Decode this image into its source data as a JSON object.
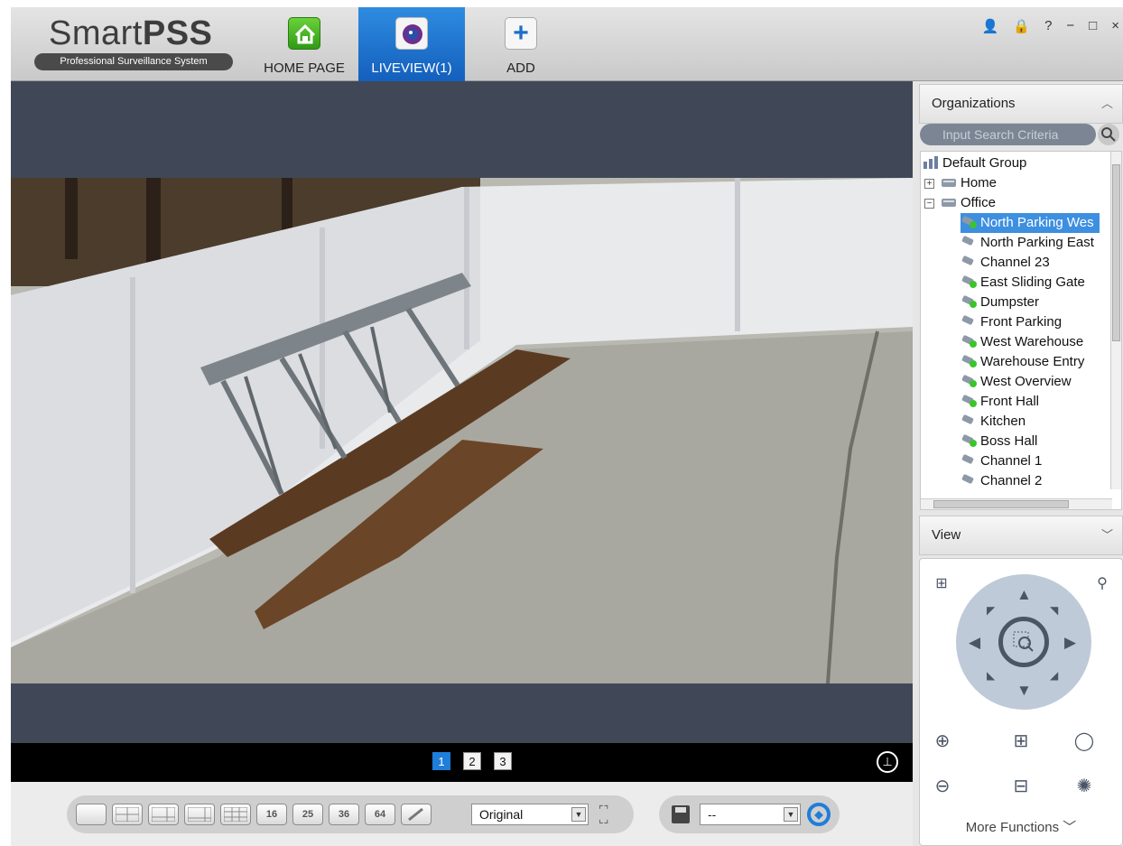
{
  "app": {
    "logo_main": "Smart",
    "logo_bold": "PSS",
    "logo_sub": "Professional Surveillance System"
  },
  "tabs": [
    {
      "label": "HOME PAGE",
      "icon": "home-icon"
    },
    {
      "label": "LIVEVIEW(1)",
      "icon": "camera-lens-icon"
    },
    {
      "label": "ADD",
      "icon": "plus-icon"
    }
  ],
  "window_controls": [
    "👤",
    "🔒",
    "?",
    "−",
    "□",
    "×"
  ],
  "pages": [
    "1",
    "2",
    "3"
  ],
  "active_page": "1",
  "toolbar": {
    "layouts": [
      "",
      "",
      "",
      "",
      "",
      "16",
      "25",
      "36",
      "64"
    ],
    "scale_value": "Original",
    "preset_value": "--"
  },
  "panel": {
    "organizations_title": "Organizations",
    "search_placeholder": "Input Search Criteria",
    "view_title": "View",
    "more_functions": "More Functions"
  },
  "tree": [
    {
      "label": "Default Group",
      "level": 0,
      "type": "group",
      "expander": ""
    },
    {
      "label": "Home",
      "level": 1,
      "type": "device",
      "expander": "+"
    },
    {
      "label": "Office",
      "level": 1,
      "type": "device",
      "expander": "−"
    },
    {
      "label": "North Parking Wes",
      "level": 2,
      "type": "camera-online",
      "selected": true
    },
    {
      "label": "North Parking East",
      "level": 2,
      "type": "camera-offline"
    },
    {
      "label": "Channel 23",
      "level": 2,
      "type": "camera-offline"
    },
    {
      "label": "East Sliding Gate",
      "level": 2,
      "type": "camera-online"
    },
    {
      "label": "Dumpster",
      "level": 2,
      "type": "camera-online"
    },
    {
      "label": "Front Parking",
      "level": 2,
      "type": "camera-offline"
    },
    {
      "label": "West Warehouse",
      "level": 2,
      "type": "camera-online"
    },
    {
      "label": "Warehouse Entry",
      "level": 2,
      "type": "camera-online"
    },
    {
      "label": "West Overview",
      "level": 2,
      "type": "camera-online"
    },
    {
      "label": "Front Hall",
      "level": 2,
      "type": "camera-online"
    },
    {
      "label": "Kitchen",
      "level": 2,
      "type": "camera-offline"
    },
    {
      "label": "Boss Hall",
      "level": 2,
      "type": "camera-online"
    },
    {
      "label": "Channel 1",
      "level": 2,
      "type": "camera-offline"
    },
    {
      "label": "Channel 2",
      "level": 2,
      "type": "camera-offline"
    }
  ],
  "colors": {
    "accent": "#1f7ed8",
    "online": "#3bc52c",
    "video_bg": "#404857"
  }
}
